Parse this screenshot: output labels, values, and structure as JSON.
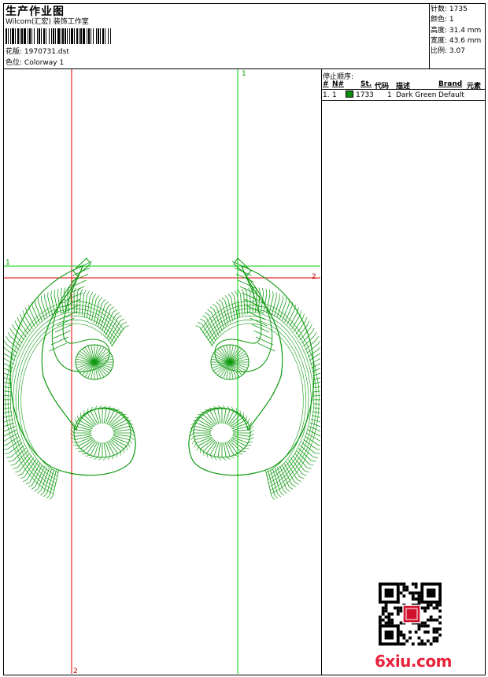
{
  "header": {
    "title": "生产作业图",
    "studio": "Wilcom(汇宏) 装饰工作室",
    "design_label": "花版:",
    "design_value": "1970731.dst",
    "colorway_label": "色位:",
    "colorway_value": "Colorway 1"
  },
  "stats": {
    "stitches": "针数: 1735",
    "colors": "颜色: 1",
    "height": "高度: 31.4 mm",
    "width": "宽度: 43.6 mm",
    "scale": "比例: 3.07"
  },
  "stop_sequence": {
    "title": "停止顺序:",
    "headers": {
      "hash": "#",
      "no": "N#",
      "st": "St.",
      "code": "代码",
      "desc": "描述",
      "brand": "Brand",
      "element": "元素"
    },
    "rows": [
      {
        "hash": "1.",
        "no": "1",
        "st": "1733",
        "code": "1",
        "desc": "Dark Green",
        "brand": "Default",
        "color": "#0f8f0f"
      }
    ]
  },
  "canvas": {
    "guide_labels": {
      "green_top": "1",
      "green_left": "1",
      "red_right": "2",
      "red_bottom": "2"
    },
    "thread_color": "#0f9a0f",
    "red_guide_color": "#e00000",
    "green_guide_color": "#00d000"
  },
  "watermark": {
    "text": "6xiu.com"
  }
}
